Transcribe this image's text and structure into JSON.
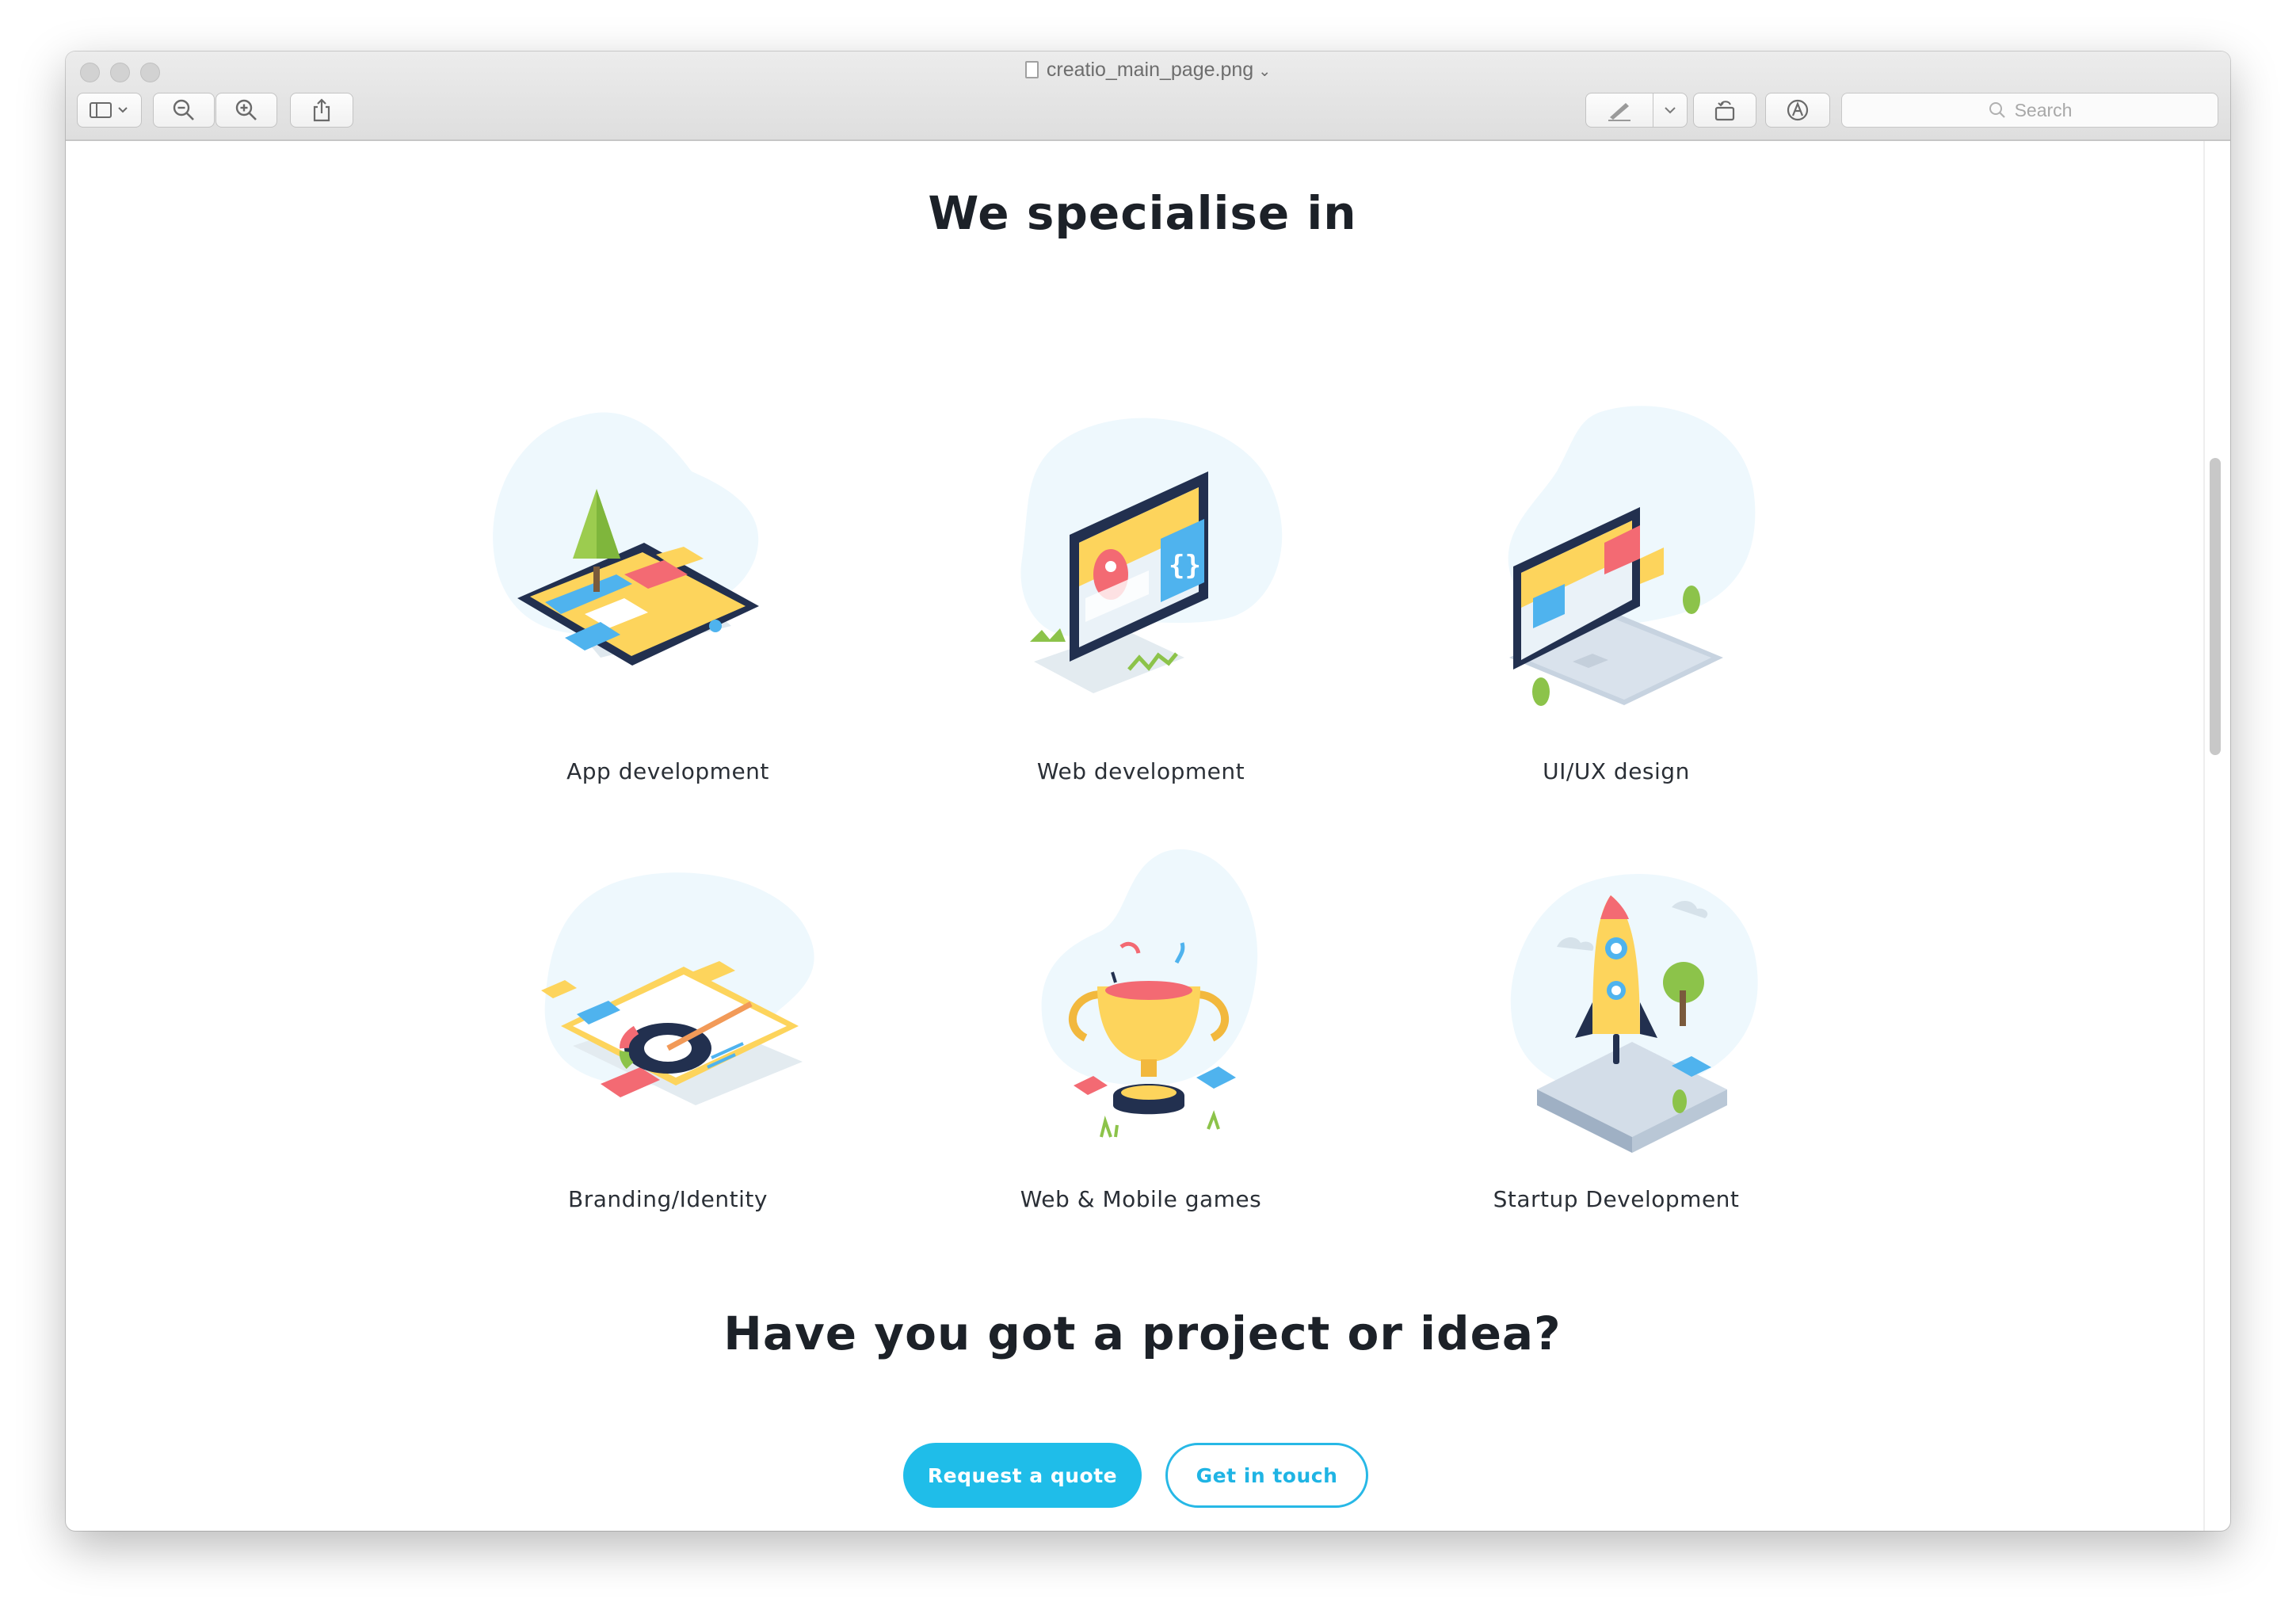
{
  "window": {
    "title": "creatio_main_page.png",
    "search_placeholder": "Search"
  },
  "page": {
    "heading": "We specialise in",
    "services": [
      {
        "label": "App development",
        "icon": "phone-app-illustration"
      },
      {
        "label": "Web development",
        "icon": "browser-code-illustration"
      },
      {
        "label": "UI/UX design",
        "icon": "laptop-ui-illustration"
      },
      {
        "label": "Branding/Identity",
        "icon": "branding-paper-illustration"
      },
      {
        "label": "Web & Mobile games",
        "icon": "trophy-illustration"
      },
      {
        "label": "Startup Development",
        "icon": "rocket-illustration"
      }
    ],
    "cta_heading": "Have you got a project or idea?",
    "cta_primary": "Request a quote",
    "cta_secondary": "Get in touch"
  },
  "colors": {
    "accent": "#1fbde9",
    "blob": "#eef8fd",
    "heading": "#1c2128",
    "yellow": "#fdd45c",
    "red": "#f36a73",
    "blue": "#4fb3ee",
    "navy": "#263553",
    "green": "#8cc34a"
  }
}
